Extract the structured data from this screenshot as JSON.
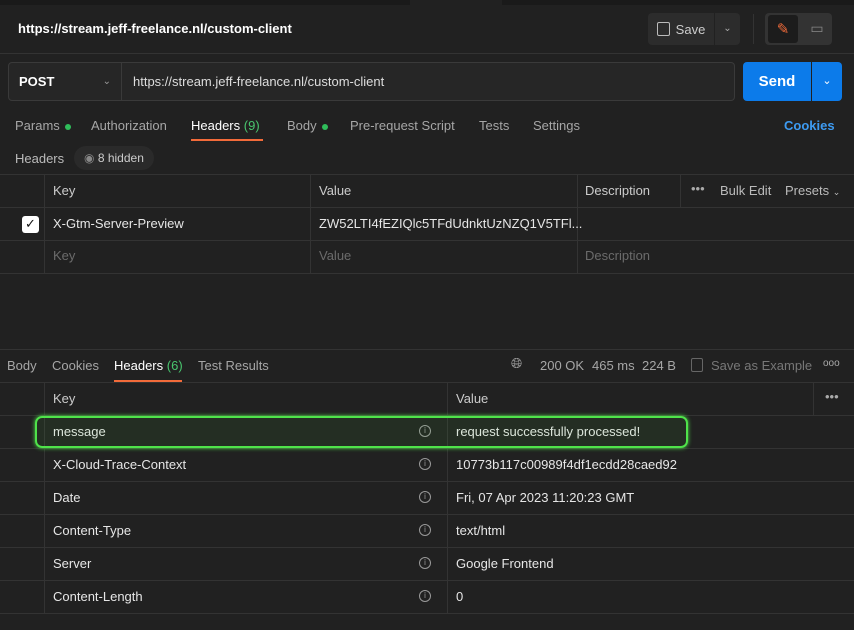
{
  "title": "https://stream.jeff-freelance.nl/custom-client",
  "save_label": "Save",
  "request": {
    "method": "POST",
    "url": "https://stream.jeff-freelance.nl/custom-client",
    "send_label": "Send"
  },
  "tabs": [
    {
      "label": "Params"
    },
    {
      "label": "Authorization"
    },
    {
      "label": "Headers",
      "count": "(9)"
    },
    {
      "label": "Body"
    },
    {
      "label": "Pre-request Script"
    },
    {
      "label": "Tests"
    },
    {
      "label": "Settings"
    }
  ],
  "cookies_link": "Cookies",
  "headers_section": {
    "label": "Headers",
    "hidden": "8 hidden"
  },
  "req_table": {
    "columns": [
      "Key",
      "Value",
      "Description"
    ],
    "bulk_edit": "Bulk Edit",
    "presets": "Presets",
    "rows": [
      {
        "checked": true,
        "key": "X-Gtm-Server-Preview",
        "value": "ZW52LTI4fEZIQlc5TFdUdnktUzNZQ1V5TFl..."
      }
    ],
    "placeholder": {
      "key": "Key",
      "value": "Value",
      "description": "Description"
    }
  },
  "response": {
    "tabs": [
      {
        "label": "Body"
      },
      {
        "label": "Cookies"
      },
      {
        "label": "Headers",
        "count": "(6)"
      },
      {
        "label": "Test Results"
      }
    ],
    "status": "200 OK",
    "time": "465 ms",
    "size": "224 B",
    "save_example": "Save as Example",
    "columns": [
      "Key",
      "Value"
    ],
    "rows": [
      {
        "key": "message",
        "value": "request successfully processed!"
      },
      {
        "key": "X-Cloud-Trace-Context",
        "value": "10773b117c00989f4df1ecdd28caed92"
      },
      {
        "key": "Date",
        "value": "Fri, 07 Apr 2023 11:20:23 GMT"
      },
      {
        "key": "Content-Type",
        "value": "text/html"
      },
      {
        "key": "Server",
        "value": "Google Frontend"
      },
      {
        "key": "Content-Length",
        "value": "0"
      }
    ]
  },
  "colors": {
    "accent": "#0c7bea",
    "active_tab": "#f26b3a",
    "highlight": "#4fe34a",
    "status": "#49c56e"
  }
}
